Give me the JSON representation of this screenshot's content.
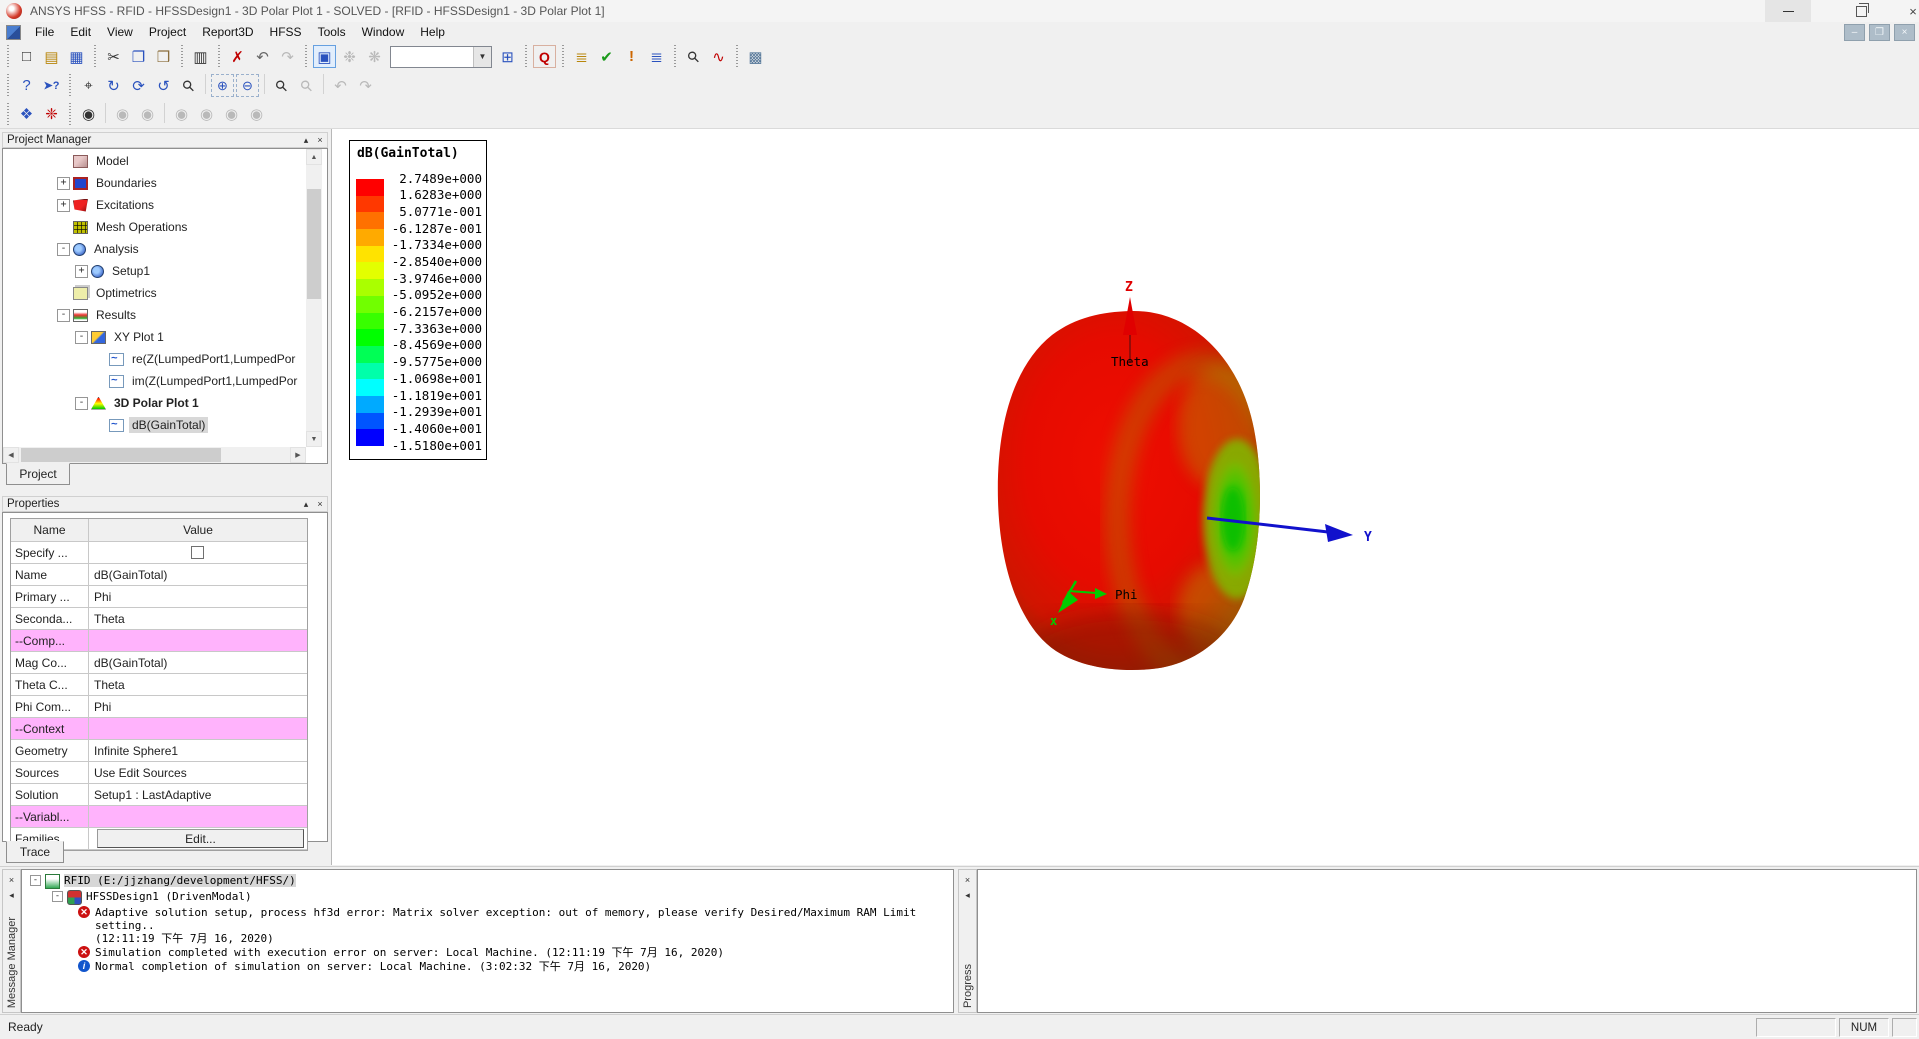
{
  "window": {
    "title": "ANSYS HFSS - RFID - HFSSDesign1 - 3D Polar Plot 1 - SOLVED - [RFID - HFSSDesign1 - 3D Polar Plot 1]"
  },
  "menu": {
    "items": [
      {
        "label": "File"
      },
      {
        "label": "Edit"
      },
      {
        "label": "View"
      },
      {
        "label": "Project"
      },
      {
        "label": "Report3D"
      },
      {
        "label": "HFSS"
      },
      {
        "label": "Tools"
      },
      {
        "label": "Window"
      },
      {
        "label": "Help"
      }
    ]
  },
  "toolbars": {
    "row1a": [
      {
        "name": "grip",
        "glyph": "",
        "cls": "grip"
      },
      {
        "name": "new-button",
        "glyph": "□",
        "cls": "dark"
      },
      {
        "name": "open-button",
        "glyph": "▤",
        "cls": "yellow"
      },
      {
        "name": "save-button",
        "glyph": "▦",
        "cls": "blue"
      },
      {
        "name": "grip",
        "glyph": "",
        "cls": "grip"
      },
      {
        "name": "cut-button",
        "glyph": "✂",
        "cls": "dark"
      },
      {
        "name": "copy-button",
        "glyph": "❐",
        "cls": "blue"
      },
      {
        "name": "paste-button",
        "glyph": "❒",
        "cls": "brown"
      },
      {
        "name": "grip",
        "glyph": "",
        "cls": "grip"
      },
      {
        "name": "print-button",
        "glyph": "▥",
        "cls": "dark"
      },
      {
        "name": "grip",
        "glyph": "",
        "cls": "grip"
      },
      {
        "name": "delete-button",
        "glyph": "✗",
        "cls": "red"
      },
      {
        "name": "undo-button",
        "glyph": "↶",
        "cls": "gray"
      },
      {
        "name": "redo-button",
        "glyph": "↷",
        "cls": "disabled"
      },
      {
        "name": "grip",
        "glyph": "",
        "cls": "grip"
      },
      {
        "name": "validation-check-button",
        "glyph": "▣",
        "cls": "active"
      },
      {
        "name": "analyze-all-button",
        "glyph": "❉",
        "cls": "disabled"
      },
      {
        "name": "submit-job-button",
        "glyph": "❋",
        "cls": "disabled"
      }
    ],
    "row1b": [
      {
        "name": "apply-solved-variation-button",
        "glyph": "⊞",
        "cls": "blue"
      },
      {
        "name": "grip",
        "glyph": "",
        "cls": "grip"
      },
      {
        "name": "field-overlay-button",
        "glyph": "Q",
        "cls": "redbold"
      },
      {
        "name": "grip",
        "glyph": "",
        "cls": "grip"
      },
      {
        "name": "solution-data-button",
        "glyph": "≣",
        "cls": "yellow"
      },
      {
        "name": "validate-design-button",
        "glyph": "✔",
        "cls": "green"
      },
      {
        "name": "show-messages-button",
        "glyph": "!",
        "cls": "orange"
      },
      {
        "name": "report-list-button",
        "glyph": "≣",
        "cls": "blue"
      },
      {
        "name": "grip",
        "glyph": "",
        "cls": "grip"
      },
      {
        "name": "zoom-results-button",
        "glyph": "⚲",
        "cls": "mag"
      },
      {
        "name": "create-report-button",
        "glyph": "∿",
        "cls": "red"
      },
      {
        "name": "grip",
        "glyph": "",
        "cls": "grip"
      },
      {
        "name": "copy-image-button",
        "glyph": "▩",
        "cls": "slate"
      }
    ],
    "row2": [
      {
        "name": "grip",
        "glyph": "",
        "cls": "grip"
      },
      {
        "name": "help-button",
        "glyph": "?",
        "cls": "blue"
      },
      {
        "name": "context-help-button",
        "glyph": "➤?",
        "cls": "helpptr"
      },
      {
        "name": "grip",
        "glyph": "",
        "cls": "grip"
      },
      {
        "name": "pan-button",
        "glyph": "⌖",
        "cls": "dark"
      },
      {
        "name": "rotate-center-button",
        "glyph": "↻",
        "cls": "blue"
      },
      {
        "name": "rotate-axis-button",
        "glyph": "⟳",
        "cls": "blue"
      },
      {
        "name": "rotate-screen-button",
        "glyph": "↺",
        "cls": "blue"
      },
      {
        "name": "zoom-one-button",
        "glyph": "⚲",
        "cls": "mag"
      },
      {
        "name": "sep",
        "glyph": "",
        "cls": "sep"
      },
      {
        "name": "zoom-in-region-button",
        "glyph": "⊕",
        "cls": "dashedblue"
      },
      {
        "name": "zoom-out-region-button",
        "glyph": "⊖",
        "cls": "dashedblue"
      },
      {
        "name": "sep",
        "glyph": "",
        "cls": "sep"
      },
      {
        "name": "magnify-button",
        "glyph": "⚲",
        "cls": "mag"
      },
      {
        "name": "magnify-off-button",
        "glyph": "⚲",
        "cls": "magdis"
      },
      {
        "name": "sep",
        "glyph": "",
        "cls": "sep"
      },
      {
        "name": "view-undo-button",
        "glyph": "↶",
        "cls": "disabled"
      },
      {
        "name": "view-redo-button",
        "glyph": "↷",
        "cls": "disabled"
      }
    ],
    "row3": [
      {
        "name": "grip",
        "glyph": "",
        "cls": "grip"
      },
      {
        "name": "solids-3d-button",
        "glyph": "❖",
        "cls": "blue"
      },
      {
        "name": "radiation-button",
        "glyph": "❈",
        "cls": "red"
      },
      {
        "name": "grip",
        "glyph": "",
        "cls": "grip"
      },
      {
        "name": "visibility-button",
        "glyph": "◉",
        "cls": "dark"
      },
      {
        "name": "sep",
        "glyph": "",
        "cls": "sep"
      },
      {
        "name": "visibility-button-2",
        "glyph": "◉",
        "cls": "disabled"
      },
      {
        "name": "visibility-button-3",
        "glyph": "◉",
        "cls": "disabled"
      },
      {
        "name": "sep",
        "glyph": "",
        "cls": "sep"
      },
      {
        "name": "visibility-button-4",
        "glyph": "◉",
        "cls": "disabled"
      },
      {
        "name": "visibility-button-5",
        "glyph": "◉",
        "cls": "disabled"
      },
      {
        "name": "visibility-button-6",
        "glyph": "◉",
        "cls": "disabled"
      },
      {
        "name": "visibility-button-7",
        "glyph": "◉",
        "cls": "disabled"
      }
    ],
    "combo_arrow": "▼"
  },
  "project_manager": {
    "title": "Project Manager",
    "collapse_glyph": "▴",
    "close_glyph": "×",
    "tab": "Project",
    "tree": [
      {
        "label": "Model",
        "icon": "model-icon",
        "expand": "",
        "indent": 0,
        "cls": "plain"
      },
      {
        "label": "Boundaries",
        "icon": "boundaries-icon",
        "expand": "+",
        "indent": 0,
        "cls": "plain"
      },
      {
        "label": "Excitations",
        "icon": "excitations-icon",
        "expand": "+",
        "indent": 0,
        "cls": "plain"
      },
      {
        "label": "Mesh Operations",
        "icon": "mesh-operations-icon",
        "expand": "",
        "indent": 0,
        "cls": "plain"
      },
      {
        "label": "Analysis",
        "icon": "analysis-icon",
        "expand": "-",
        "indent": 0,
        "cls": "plain"
      },
      {
        "label": "Setup1",
        "icon": "setup-icon",
        "expand": "+",
        "indent": 1,
        "cls": "plain"
      },
      {
        "label": "Optimetrics",
        "icon": "optimetrics-icon",
        "expand": "",
        "indent": 0,
        "cls": "plain"
      },
      {
        "label": "Results",
        "icon": "results-icon",
        "expand": "-",
        "indent": 0,
        "cls": "plain"
      },
      {
        "label": "XY Plot 1",
        "icon": "xy-plot-icon",
        "expand": "-",
        "indent": 1,
        "cls": "plain"
      },
      {
        "label": "re(Z(LumpedPort1,LumpedPor",
        "icon": "trace-icon",
        "expand": "",
        "indent": 2,
        "cls": "plain"
      },
      {
        "label": "im(Z(LumpedPort1,LumpedPor",
        "icon": "trace-icon",
        "expand": "",
        "indent": 2,
        "cls": "plain"
      },
      {
        "label": "3D Polar Plot 1",
        "icon": "polar-plot-icon",
        "expand": "-",
        "indent": 1,
        "cls": "bold"
      },
      {
        "label": "dB(GainTotal)",
        "icon": "trace-icon",
        "expand": "",
        "indent": 2,
        "cls": "selected"
      }
    ]
  },
  "properties": {
    "title": "Properties",
    "collapse_glyph": "▴",
    "close_glyph": "×",
    "tab": "Trace",
    "columns": {
      "name": "Name",
      "value": "Value"
    },
    "rows": [
      {
        "name": "Specify ...",
        "value": "",
        "kind": "checkbox"
      },
      {
        "name": "Name",
        "value": "dB(GainTotal)",
        "kind": "text"
      },
      {
        "name": "Primary ...",
        "value": "Phi",
        "kind": "text"
      },
      {
        "name": "Seconda...",
        "value": "Theta",
        "kind": "text"
      },
      {
        "name": "--Comp...",
        "value": "",
        "kind": "section"
      },
      {
        "name": "Mag Co...",
        "value": "dB(GainTotal)",
        "kind": "text"
      },
      {
        "name": "Theta C...",
        "value": "Theta",
        "kind": "text"
      },
      {
        "name": "Phi Com...",
        "value": "Phi",
        "kind": "text"
      },
      {
        "name": "--Context",
        "value": "",
        "kind": "section"
      },
      {
        "name": "Geometry",
        "value": "Infinite Sphere1",
        "kind": "text"
      },
      {
        "name": "Sources",
        "value": "Use Edit Sources",
        "kind": "text"
      },
      {
        "name": "Solution",
        "value": "Setup1 : LastAdaptive",
        "kind": "text"
      },
      {
        "name": "--Variabl...",
        "value": "",
        "kind": "section"
      },
      {
        "name": "Families",
        "value": "Edit...",
        "kind": "button"
      }
    ]
  },
  "legend": {
    "title": "dB(GainTotal)",
    "values": [
      "2.7489e+000",
      "1.6283e+000",
      "5.0771e-001",
      "-6.1287e-001",
      "-1.7334e+000",
      "-2.8540e+000",
      "-3.9746e+000",
      "-5.0952e+000",
      "-6.2157e+000",
      "-7.3363e+000",
      "-8.4569e+000",
      "-9.5775e+000",
      "-1.0698e+001",
      "-1.1819e+001",
      "-1.2939e+001",
      "-1.4060e+001",
      "-1.5180e+001"
    ],
    "colors": [
      "#ff0000",
      "#ff3800",
      "#ff7100",
      "#ffaa00",
      "#ffe300",
      "#e3ff00",
      "#aaff00",
      "#71ff00",
      "#38ff00",
      "#00ff00",
      "#00ff55",
      "#00ffaa",
      "#00ffff",
      "#00aaff",
      "#0055ff",
      "#0000ff"
    ]
  },
  "plot": {
    "axis_z": "Z",
    "axis_theta": "Theta",
    "axis_y": "Y",
    "axis_phi": "Phi",
    "axis_x": "x"
  },
  "message_manager": {
    "vertical_label": "Message Manager",
    "close_glyph": "×",
    "pin_glyph": "◂",
    "expand_glyph": "-",
    "project": "RFID (E:/jjzhang/development/HFSS/)",
    "design": "HFSSDesign1 (DrivenModal)",
    "messages": [
      {
        "cls": "error",
        "icon_glyph": "✕",
        "text": "Adaptive solution setup, process hf3d error: Matrix solver exception: out of memory, please verify Desired/Maximum RAM Limit setting..",
        "line2": "(12:11:19 下午  7月 16, 2020)"
      },
      {
        "cls": "error",
        "icon_glyph": "✕",
        "text": "Simulation completed with execution error on server: Local Machine.  (12:11:19 下午  7月 16, 2020)",
        "line2": ""
      },
      {
        "cls": "info",
        "icon_glyph": "i",
        "text": "Normal completion of simulation on server: Local Machine.  (3:02:32 下午  7月 16, 2020)",
        "line2": ""
      }
    ]
  },
  "progress": {
    "vertical_label": "Progress",
    "close_glyph": "×",
    "pin_glyph": "◂"
  },
  "status_bar": {
    "ready": "Ready",
    "num": "NUM"
  }
}
